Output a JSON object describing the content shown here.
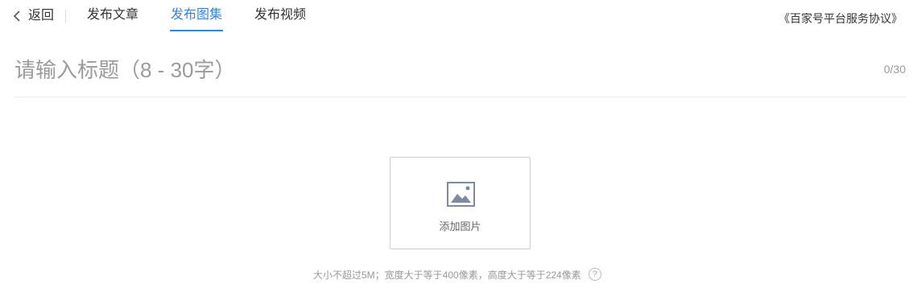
{
  "nav": {
    "back_label": "返回",
    "tabs": [
      {
        "label": "发布文章"
      },
      {
        "label": "发布图集"
      },
      {
        "label": "发布视频"
      }
    ],
    "active_tab": "发布图集",
    "agreement_link": "《百家号平台服务协议》"
  },
  "title": {
    "placeholder": "请输入标题（8 - 30字）",
    "value": "",
    "counter": "0/30"
  },
  "upload": {
    "label": "添加图片",
    "hint": "大小不超过5M；宽度大于等于400像素，高度大于等于224像素",
    "help_glyph": "?"
  },
  "colors": {
    "accent": "#3b82d6",
    "text": "#333333",
    "muted": "#999999"
  }
}
